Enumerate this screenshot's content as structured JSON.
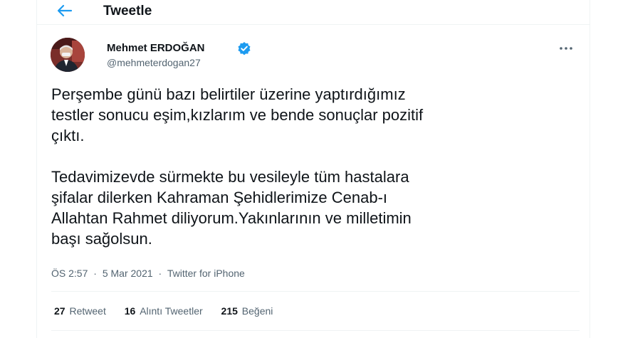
{
  "header": {
    "title": "Tweetle",
    "back_icon": "arrow-left-icon"
  },
  "colors": {
    "accent": "#1d9bf0",
    "text_primary": "#0f1419",
    "text_secondary": "#536471",
    "divider": "#eff3f4"
  },
  "tweet": {
    "author_name": "Mehmet ERDOĞAN",
    "author_handle": "@mehmeterdogan27",
    "verified_icon": "verified-badge-icon",
    "more_icon": "more-dots-icon",
    "text_lines": [
      "Perşembe günü bazı belirtiler üzerine yaptırdığımız",
      "testler sonucu eşim,kızlarım ve bende sonuçlar pozitif",
      "çıktı.",
      "Tedavimizevde sürmekte bu vesileyle tüm hastalara",
      "şifalar dilerken Kahraman Şehidlerimize Cenab-ı",
      "Allahtan Rahmet diliyorum.Yakınlarının ve milletimin",
      "başı sağolsun."
    ],
    "time": "ÖS 2:57",
    "date": "5 Mar 2021",
    "source": "Twitter for iPhone",
    "separator": "·"
  },
  "stats": [
    {
      "count": "27",
      "label": "Retweet"
    },
    {
      "count": "16",
      "label": "Alıntı Tweetler"
    },
    {
      "count": "215",
      "label": "Beğeni"
    }
  ]
}
